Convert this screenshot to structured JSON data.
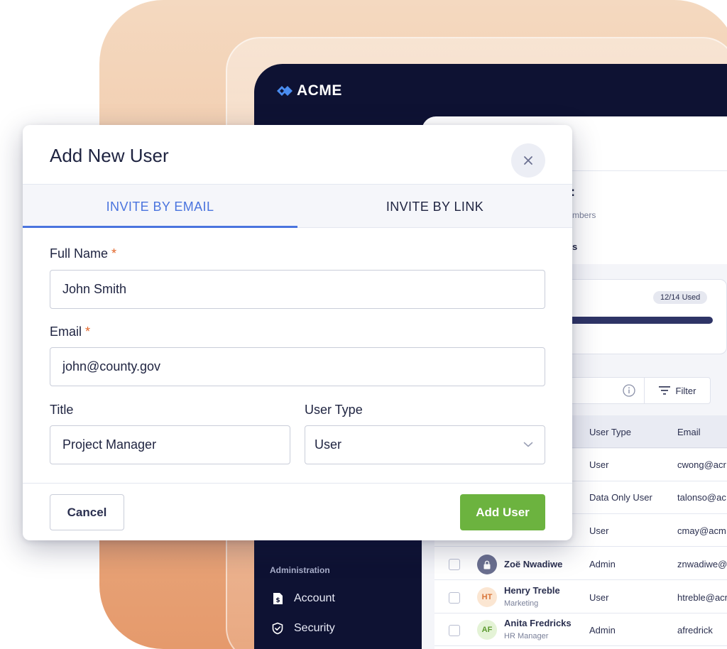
{
  "brand": {
    "name": "ACME"
  },
  "sidebar": {
    "section_label": "Administration",
    "items": [
      {
        "label": "Account",
        "icon": "dollar-doc-icon"
      },
      {
        "label": "Security",
        "icon": "shield-icon"
      }
    ]
  },
  "content": {
    "title_fragment": ":",
    "subtitle_fragment": "mbers",
    "tab_fragment": "s",
    "seats_badge": "12/14 Used",
    "seats_used": 12,
    "seats_total": 14,
    "filter_label": "Filter",
    "table": {
      "headers": {
        "user_type": "User Type",
        "email": "Email"
      },
      "rows": [
        {
          "name": "",
          "subtitle": "",
          "initials": "",
          "user_type": "User",
          "email": "cwong@acr"
        },
        {
          "name": "",
          "subtitle": "",
          "initials": "",
          "user_type": "Data Only User",
          "email": "talonso@ac"
        },
        {
          "name": "",
          "subtitle": "",
          "initials": "",
          "user_type": "User",
          "email": "cmay@acm"
        },
        {
          "name": "Zoë Nwadiwe",
          "subtitle": "",
          "initials": "",
          "user_type": "Admin",
          "email": "znwadiwe@"
        },
        {
          "name": "Henry Treble",
          "subtitle": "Marketing",
          "initials": "HT",
          "user_type": "User",
          "email": "htreble@acr"
        },
        {
          "name": "Anita Fredricks",
          "subtitle": "HR Manager",
          "initials": "AF",
          "user_type": "Admin",
          "email": "afredrick"
        }
      ]
    }
  },
  "modal": {
    "title": "Add New User",
    "tabs": [
      {
        "label": "INVITE BY EMAIL",
        "active": true
      },
      {
        "label": "INVITE BY LINK",
        "active": false
      }
    ],
    "fields": {
      "full_name": {
        "label": "Full Name",
        "required_mark": "*",
        "value": "John Smith"
      },
      "email": {
        "label": "Email",
        "required_mark": "*",
        "value": "john@county.gov"
      },
      "title": {
        "label": "Title",
        "value": "Project Manager"
      },
      "user_type": {
        "label": "User Type",
        "value": "User"
      }
    },
    "buttons": {
      "cancel": "Cancel",
      "add": "Add User"
    }
  },
  "colors": {
    "accent_blue": "#4a74de",
    "primary_green": "#6cb33f",
    "required_orange": "#e2672b",
    "sidebar_navy": "#0e1233"
  }
}
